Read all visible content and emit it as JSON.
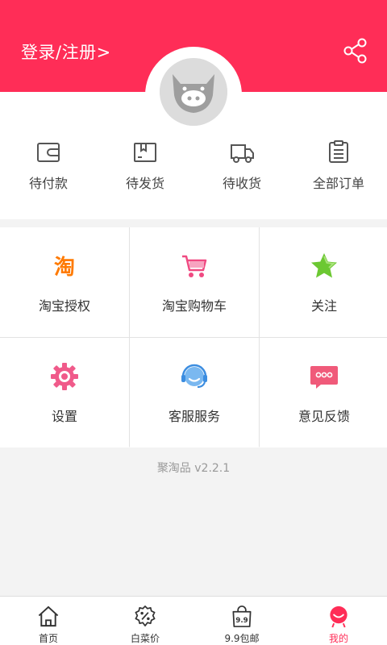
{
  "header": {
    "login_label": "登录/注册>",
    "share_icon": "share-icon",
    "accent_color": "#ff2d57"
  },
  "orders": [
    {
      "label": "待付款",
      "icon": "wallet-icon"
    },
    {
      "label": "待发货",
      "icon": "package-icon"
    },
    {
      "label": "待收货",
      "icon": "truck-icon"
    },
    {
      "label": "全部订单",
      "icon": "clipboard-icon"
    }
  ],
  "services": [
    {
      "label": "淘宝授权",
      "icon": "taobao-icon"
    },
    {
      "label": "淘宝购物车",
      "icon": "cart-icon"
    },
    {
      "label": "关注",
      "icon": "star-icon"
    },
    {
      "label": "设置",
      "icon": "gear-icon"
    },
    {
      "label": "客服服务",
      "icon": "headset-icon"
    },
    {
      "label": "意见反馈",
      "icon": "message-icon"
    }
  ],
  "version": "聚淘品 v2.2.1",
  "tabs": [
    {
      "label": "首页",
      "icon": "home-icon"
    },
    {
      "label": "白菜价",
      "icon": "discount-icon"
    },
    {
      "label": "9.9包邮",
      "icon": "bag-icon"
    },
    {
      "label": "我的",
      "icon": "profile-icon",
      "active": true
    }
  ]
}
